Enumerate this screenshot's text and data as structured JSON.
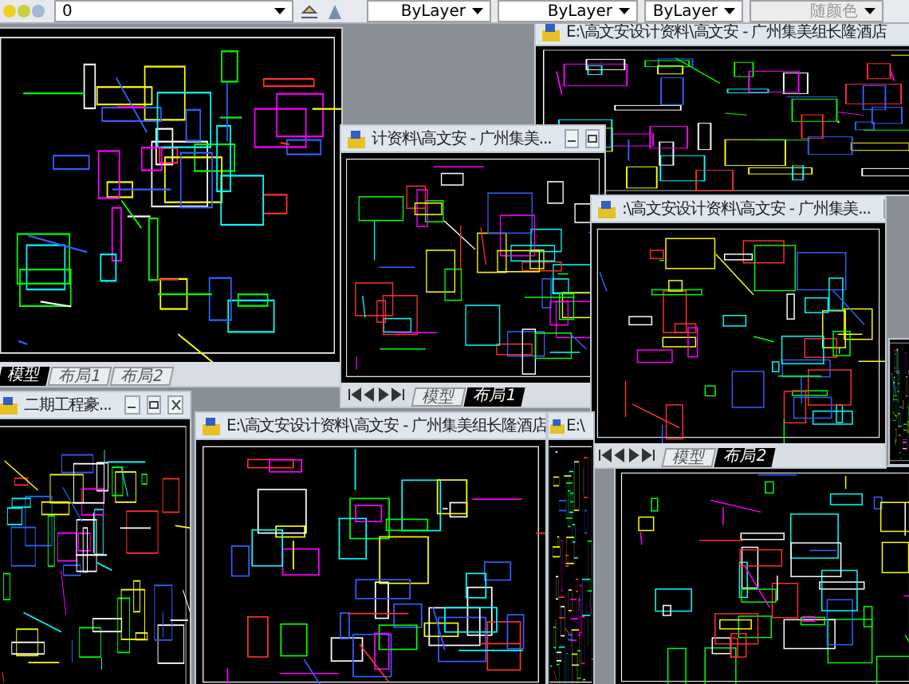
{
  "toolbar": {
    "layer": "0",
    "color_setting": "ByLayer",
    "linetype": "ByLayer",
    "lineweight": "ByLayer",
    "plot_style": "随颜色"
  },
  "windows": [
    {
      "title": "E:\\高文安设计资料\\高文安 - 广州集美组长隆酒店"
    },
    {
      "tabs": [
        {
          "label": "模型",
          "selected": true
        },
        {
          "label": "布局1",
          "selected": false
        },
        {
          "label": "布局2",
          "selected": false
        }
      ]
    },
    {
      "title": "计资料\\高文安 - 广州集美...",
      "tabs": [
        {
          "label": "模型",
          "selected": false
        },
        {
          "label": "布局1",
          "selected": true
        }
      ]
    },
    {
      "title": ":\\高文安设计资料\\高文安 - 广州集美...",
      "tabs": [
        {
          "label": "模型",
          "selected": false
        },
        {
          "label": "布局2",
          "selected": true
        }
      ]
    },
    {
      "title": "二期工程豪..."
    },
    {
      "title": "E:\\高文安设计资料\\高文安 - 广州集美组长隆酒店"
    },
    {
      "title": "E:\\"
    }
  ]
}
